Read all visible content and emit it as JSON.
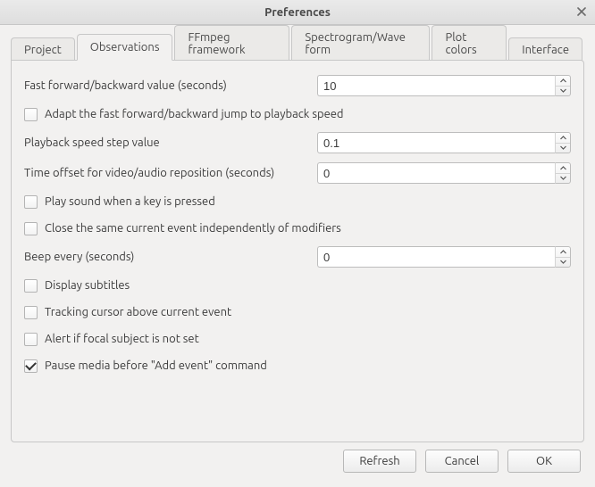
{
  "window": {
    "title": "Preferences"
  },
  "tabs": {
    "items": [
      {
        "label": "Project"
      },
      {
        "label": "Observations"
      },
      {
        "label": "FFmpeg framework"
      },
      {
        "label": "Spectrogram/Wave form"
      },
      {
        "label": "Plot colors"
      },
      {
        "label": "Interface"
      }
    ],
    "active_index": 1
  },
  "observations": {
    "fast_forward_backward_label": "Fast forward/backward value (seconds)",
    "fast_forward_backward_value": "10",
    "adapt_jump_label": "Adapt the fast forward/backward jump to playback speed",
    "adapt_jump_checked": false,
    "playback_speed_step_label": "Playback speed step value",
    "playback_speed_step_value": "0.1",
    "time_offset_label": "Time offset for video/audio reposition (seconds)",
    "time_offset_value": "0",
    "play_sound_label": "Play sound when a key is pressed",
    "play_sound_checked": false,
    "close_event_label": "Close the same current event independently of modifiers",
    "close_event_checked": false,
    "beep_every_label": "Beep every (seconds)",
    "beep_every_value": "0",
    "display_subtitles_label": "Display subtitles",
    "display_subtitles_checked": false,
    "tracking_cursor_label": "Tracking cursor above current event",
    "tracking_cursor_checked": false,
    "alert_focal_label": "Alert if focal subject is not set",
    "alert_focal_checked": false,
    "pause_media_label": "Pause media before \"Add event\" command",
    "pause_media_checked": true
  },
  "buttons": {
    "refresh": "Refresh",
    "cancel": "Cancel",
    "ok": "OK"
  }
}
